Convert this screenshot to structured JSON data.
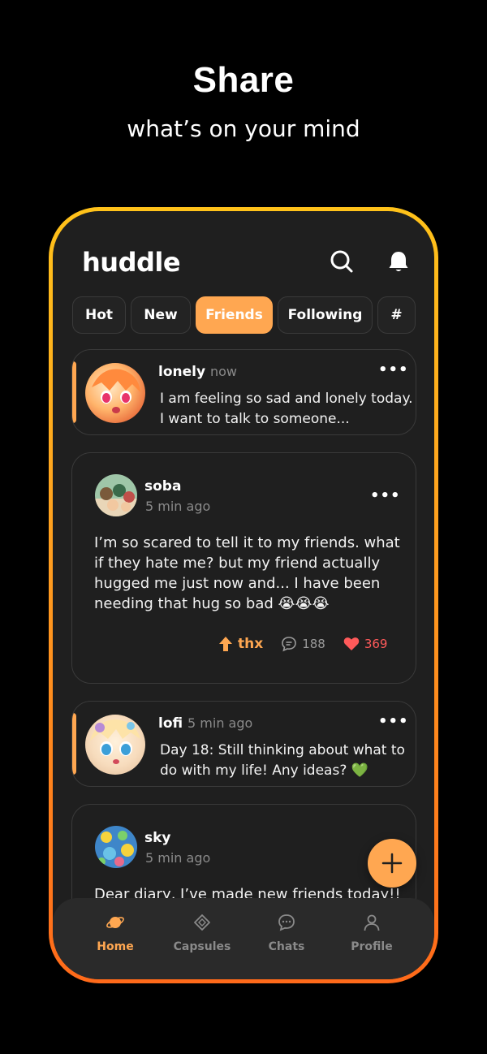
{
  "hero": {
    "title": "Share",
    "subtitle": "what’s on your mind"
  },
  "app": {
    "logo": "huddle"
  },
  "tabs": [
    {
      "label": "Hot"
    },
    {
      "label": "New"
    },
    {
      "label": "Friends"
    },
    {
      "label": "Following"
    },
    {
      "label": "#"
    }
  ],
  "posts": [
    {
      "user": "lonely",
      "time": "now",
      "text_line1": "I am feeling so sad and lonely today.",
      "text_line2": "I want to talk to someone..."
    },
    {
      "user": "soba",
      "time": "5 min ago",
      "text_line1": "I’m so scared to tell it to my friends. what",
      "text_line2": "if they hate me? but my friend actually",
      "text_line3": "hugged me just now and... I have been",
      "text_line4": "needing that hug so bad 😭😭😭",
      "thx": "thx",
      "comments": "188",
      "likes": "369"
    },
    {
      "user": "lofi",
      "time": "5 min ago",
      "text_line1": "Day 18: Still thinking about what to",
      "text_line2": "do with my life! Any ideas? 💚"
    },
    {
      "user": "sky",
      "time": "5 min ago",
      "text_line1": "Dear diary, I’ve made new friends today!!"
    }
  ],
  "nav": [
    {
      "label": "Home",
      "icon": "planet-icon"
    },
    {
      "label": "Capsules",
      "icon": "diamond-icon"
    },
    {
      "label": "Chats",
      "icon": "chat-icon"
    },
    {
      "label": "Profile",
      "icon": "person-icon"
    }
  ],
  "colors": {
    "accent": "#ffa751",
    "background": "#000000",
    "surface": "#1f1f1f",
    "like": "#ff5a5a"
  }
}
